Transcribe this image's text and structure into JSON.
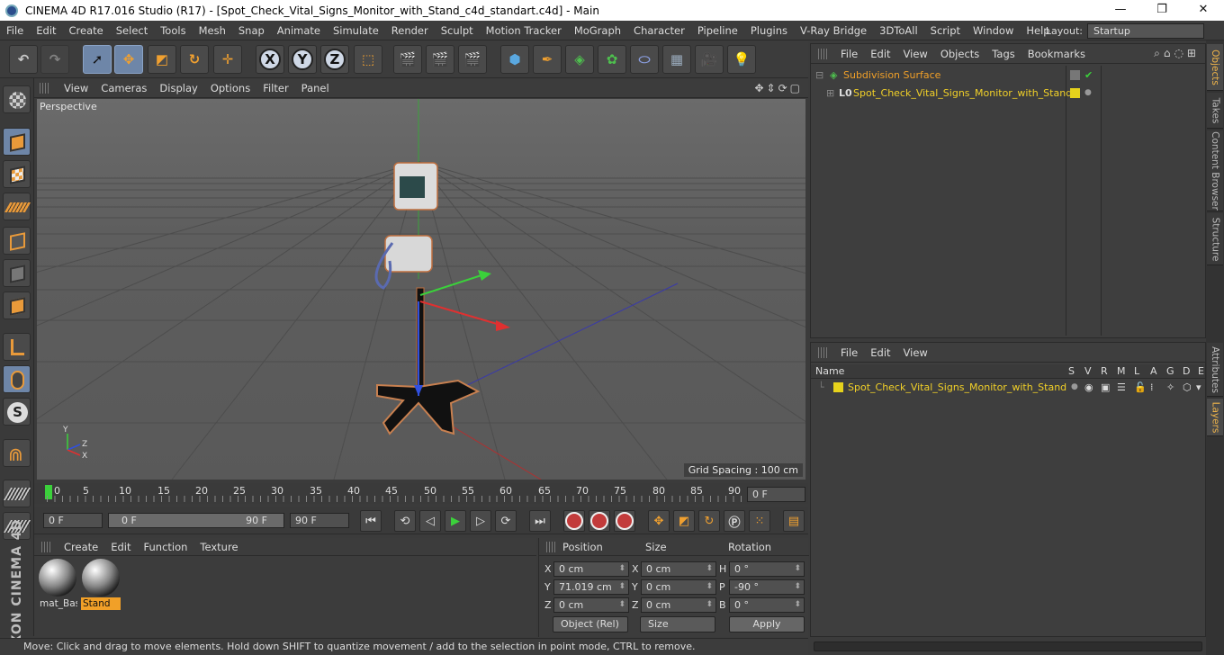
{
  "window": {
    "title": "CINEMA 4D R17.016 Studio (R17) - [Spot_Check_Vital_Signs_Monitor_with_Stand_c4d_standart.c4d] - Main",
    "controls": [
      "—",
      "❐",
      "✕"
    ]
  },
  "menubar": {
    "items": [
      "File",
      "Edit",
      "Create",
      "Select",
      "Tools",
      "Mesh",
      "Snap",
      "Animate",
      "Simulate",
      "Render",
      "Sculpt",
      "Motion Tracker",
      "MoGraph",
      "Character",
      "Pipeline",
      "Plugins",
      "V-Ray Bridge",
      "3DToAll",
      "Script",
      "Window",
      "Help"
    ],
    "layout_label": "Layout:",
    "layout_value": "Startup"
  },
  "toolbar": {
    "axis": [
      "X",
      "Y",
      "Z"
    ]
  },
  "viewport": {
    "menu": [
      "View",
      "Cameras",
      "Display",
      "Options",
      "Filter",
      "Panel"
    ],
    "label": "Perspective",
    "grid_spacing": "Grid Spacing : 100 cm",
    "axis_labels": [
      "Y",
      "Z",
      "X"
    ]
  },
  "timeline": {
    "ticks": [
      "0",
      "5",
      "10",
      "15",
      "20",
      "25",
      "30",
      "35",
      "40",
      "45",
      "50",
      "55",
      "60",
      "65",
      "70",
      "75",
      "80",
      "85",
      "90"
    ],
    "current_frame": "0 F",
    "start": "0 F",
    "range_start": "0 F",
    "range_end": "90 F",
    "end": "90 F"
  },
  "materials": {
    "menu": [
      "Create",
      "Edit",
      "Function",
      "Texture"
    ],
    "items": [
      {
        "name": "mat_Bas"
      },
      {
        "name": "Stand"
      }
    ]
  },
  "coords": {
    "headers": [
      "Position",
      "Size",
      "Rotation"
    ],
    "rows": [
      {
        "axis": "X",
        "pos": "0 cm",
        "saxis": "X",
        "size": "0 cm",
        "raxis": "H",
        "rot": "0 °"
      },
      {
        "axis": "Y",
        "pos": "71.019 cm",
        "saxis": "Y",
        "size": "0 cm",
        "raxis": "P",
        "rot": "-90 °"
      },
      {
        "axis": "Z",
        "pos": "0 cm",
        "saxis": "Z",
        "size": "0 cm",
        "raxis": "B",
        "rot": "0 °"
      }
    ],
    "mode": "Object (Rel)",
    "size_mode": "Size",
    "apply": "Apply"
  },
  "status": "Move: Click and drag to move elements. Hold down SHIFT to quantize movement / add to the selection in point mode, CTRL to remove.",
  "objects": {
    "menu": [
      "File",
      "Edit",
      "View",
      "Objects",
      "Tags",
      "Bookmarks"
    ],
    "items": [
      {
        "name": "Subdivision Surface"
      },
      {
        "name": "Spot_Check_Vital_Signs_Monitor_with_Stand"
      }
    ]
  },
  "layers": {
    "menu": [
      "File",
      "Edit",
      "View"
    ],
    "columns": [
      "Name",
      "S",
      "V",
      "R",
      "M",
      "L",
      "A",
      "G",
      "D",
      "E"
    ],
    "items": [
      {
        "name": "Spot_Check_Vital_Signs_Monitor_with_Stand"
      }
    ]
  },
  "sidetabs": [
    "Objects",
    "Takes",
    "Content Browser",
    "Structure",
    "Attributes",
    "Layers"
  ],
  "colors": {
    "accent": "#f1a028",
    "selection": "#6e86a8",
    "layer": "#e6d21c"
  }
}
